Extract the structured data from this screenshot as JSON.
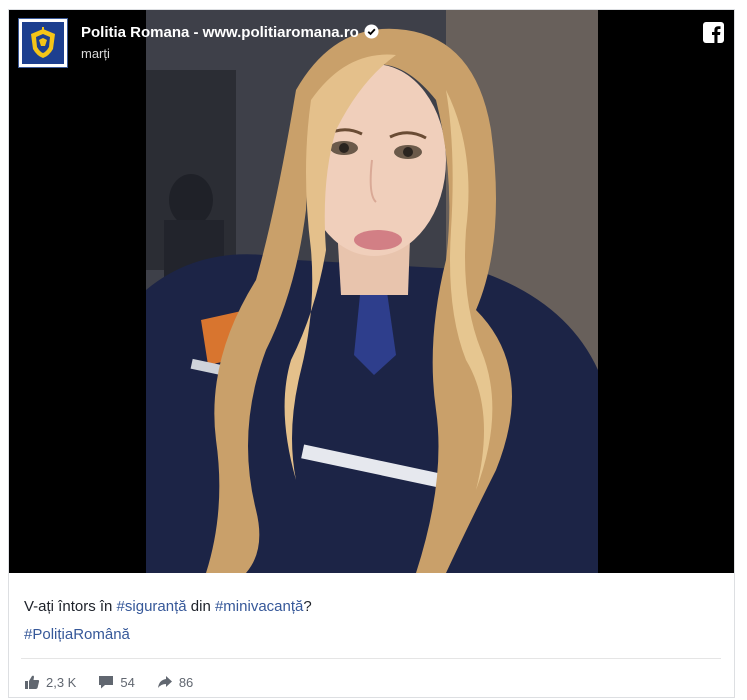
{
  "post": {
    "page_name": "Politia Romana - www.politiaromana.ro",
    "time": "marți",
    "caption": {
      "prefix": "V-ați întors în ",
      "hashtag1": "#siguranță",
      "middle": " din ",
      "hashtag2": "#minivacanță",
      "suffix": "?",
      "hashtag3": "#PolițiaRomână"
    },
    "stats": {
      "likes": "2,3 K",
      "comments": "54",
      "shares": "86"
    }
  },
  "icons": {
    "avatar": "police-crest-icon",
    "verified": "verified-badge-icon",
    "brand": "facebook-logo-icon",
    "like": "thumbs-up-icon",
    "comment": "comment-bubble-icon",
    "share": "share-arrow-icon"
  },
  "colors": {
    "media_background": "#000000",
    "hashtag": "#365899",
    "text": "#1d2129",
    "muted": "#616770",
    "crest_blue": "#1d3f8f",
    "crest_gold": "#f5c518"
  }
}
